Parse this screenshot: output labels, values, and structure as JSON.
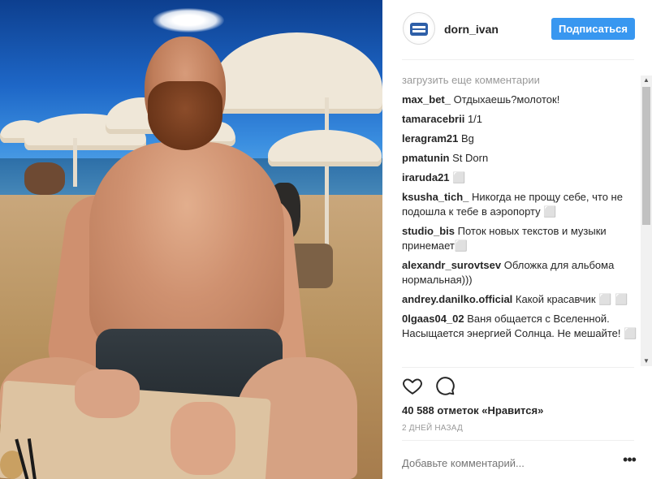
{
  "post": {
    "username": "dorn_ivan",
    "follow_label": "Подписаться",
    "load_more_label": "загрузить еще комментарии",
    "comments": [
      {
        "user": "max_bet_",
        "text": "Отдыхаешь?молоток!"
      },
      {
        "user": "tamaracebrii",
        "text": "1/1"
      },
      {
        "user": "leragram21",
        "text": "Bg"
      },
      {
        "user": "pmatunin",
        "text": "St Dorn"
      },
      {
        "user": "iraruda21",
        "text": "⬜"
      },
      {
        "user": "ksusha_tich_",
        "text": "Никогда не прощу себе, что не подошла к тебе в аэропорту ⬜"
      },
      {
        "user": "studio_bis",
        "text": "Поток новых текстов и музыки принемает⬜"
      },
      {
        "user": "alexandr_surovtsev",
        "text": "Обложка для альбома нормальная)))"
      },
      {
        "user": "andrey.danilko.official",
        "text": "Какой красавчик ⬜ ⬜"
      },
      {
        "user": "0lgaas04_02",
        "text": "Ваня общается с Вселенной. Насыщается энергией Солнца. Не мешайте! ⬜"
      }
    ],
    "likes_label": "40 588 отметок «Нравится»",
    "date_label": "2 ДНЕЙ НАЗАД",
    "add_comment_placeholder": "Добавьте комментарий...",
    "more_label": "•••"
  },
  "icons": {
    "like": "heart-icon",
    "comment": "comment-icon",
    "avatar": "avatar-logo"
  },
  "colors": {
    "follow_button": "#3897f0",
    "muted_text": "#999999"
  }
}
